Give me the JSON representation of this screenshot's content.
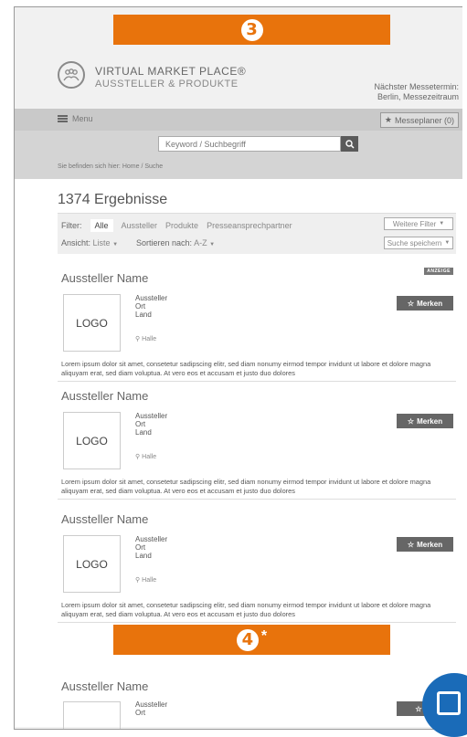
{
  "banner_top": {
    "number": "3"
  },
  "banner_middle": {
    "number": "4",
    "asterisk": "*"
  },
  "header": {
    "brand_line1": "VIRTUAL MARKET PLACE®",
    "brand_line2": "AUSSTELLER & PRODUKTE",
    "next_fair_label": "Nächster Messetermin:",
    "next_fair_value": "Berlin, Messezeitraum"
  },
  "menubar": {
    "menu_label": "Menu",
    "planner_label": "Messeplaner (0)"
  },
  "search": {
    "placeholder": "Keyword / Suchbegriff"
  },
  "breadcrumb": "Sie befinden sich hier:  Home  /  Suche",
  "results": {
    "count_text": "1374 Ergebnisse"
  },
  "filters": {
    "label": "Filter:",
    "items": [
      "Alle",
      "Aussteller",
      "Produkte",
      "Presseansprechpartner"
    ],
    "active": "Alle",
    "more_label": "Weitere Filter",
    "view_label": "Ansicht:",
    "view_value": "Liste",
    "sort_label": "Sortieren nach:",
    "sort_value": "A-Z",
    "save_search_label": "Suche speichern"
  },
  "cards": [
    {
      "badge": "ANZEIGE",
      "name": "Aussteller Name",
      "logo": "LOGO",
      "type": "Aussteller",
      "city": "Ort",
      "country": "Land",
      "hall": "Halle",
      "button": "Merken",
      "desc": "Lorem ipsum dolor sit amet, consetetur sadipscing elitr, sed diam nonumy eirmod tempor invidunt ut labore et dolore magna aliquyam erat, sed diam voluptua. At vero eos et accusam et justo duo dolores"
    },
    {
      "name": "Aussteller Name",
      "logo": "LOGO",
      "type": "Aussteller",
      "city": "Ort",
      "country": "Land",
      "hall": "Halle",
      "button": "Merken",
      "desc": "Lorem ipsum dolor sit amet, consetetur sadipscing elitr, sed diam nonumy eirmod tempor invidunt ut labore et dolore magna aliquyam erat, sed diam voluptua. At vero eos et accusam et justo duo dolores"
    },
    {
      "name": "Aussteller Name",
      "logo": "LOGO",
      "type": "Aussteller",
      "city": "Ort",
      "country": "Land",
      "hall": "Halle",
      "button": "Merken",
      "desc": "Lorem ipsum dolor sit amet, consetetur sadipscing elitr, sed diam nonumy eirmod tempor invidunt ut labore et dolore magna aliquyam erat, sed diam voluptua. At vero eos et accusam et justo duo dolores"
    },
    {
      "name": "Aussteller Name",
      "type": "Aussteller",
      "city": "Ort",
      "button": "Me"
    }
  ],
  "colors": {
    "accent_orange": "#e8730c",
    "button_gray": "#666666",
    "corner_blue": "#1a6bb8"
  }
}
